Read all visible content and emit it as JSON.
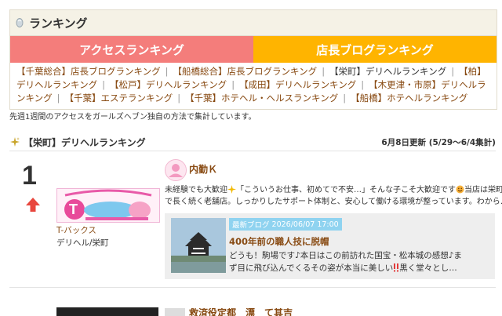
{
  "header": {
    "title": "ランキング"
  },
  "tabs": [
    {
      "label": "アクセスランキング"
    },
    {
      "label": "店長ブログランキング"
    }
  ],
  "links": [
    "【千葉総合】店長ブログランキング",
    "【船橋総合】店長ブログランキング",
    "【栄町】デリヘルランキング",
    "【柏】デリヘルランキング",
    "【松戸】デリヘルランキング",
    "【成田】デリヘルランキング",
    "【木更津・市原】デリヘルランキング",
    "【千葉】エステランキング",
    "【千葉】ホテヘル・ヘルスランキング",
    "【船橋】ホテヘルランキング"
  ],
  "note": "先週1週間のアクセスをガールズヘブン独自の方法で集計しています。",
  "section": {
    "title": "【栄町】デリヘルランキング",
    "updated": "6月8日更新 (5/29〜6/4集計)"
  },
  "entry": {
    "rank": "1",
    "trend": "up",
    "shop_name": "T-バックス",
    "shop_type": "デリヘル/栄町",
    "staff_label": "内勤Ｋ",
    "description_line1": "未経験でも大歓迎",
    "description_line1b": "「こういうお仕事、初めてで不安…」そんな子こそ大歓迎です",
    "description_line1c": "当店は栄町",
    "description_line2": "で長く続く老舗店。しっかりしたサポート体制と、安心して働ける環境が整っています。わから…",
    "blog": {
      "badge": "最新ブログ",
      "date": "2026/06/07 17:00",
      "title": "400年前の職人技に脱帽",
      "text1": "どうも！駒場です♪本日はこの前訪れた国宝・松本城の感想♪ま",
      "text2": "ず目に飛び込んでくるその姿が本当に美しい",
      "text2b": "黒く堂々とし…"
    }
  },
  "next_entry": {
    "staff_label": "救済役定都　漂　て其吉"
  },
  "colors": {
    "access_tab": "#f47d7b",
    "blog_tab": "#ffb400",
    "link": "#884a12",
    "badge": "#8fd3f0"
  }
}
